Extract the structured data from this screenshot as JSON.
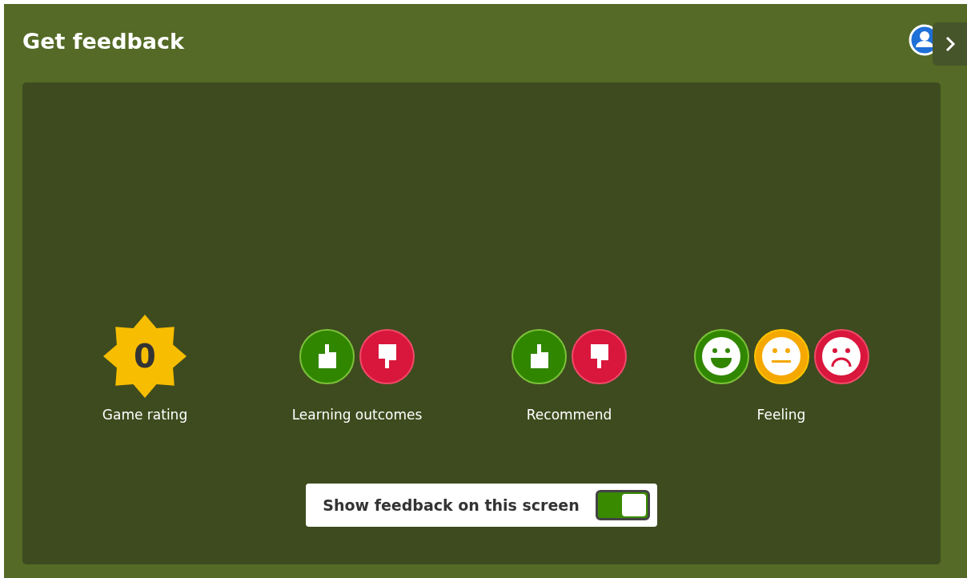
{
  "header": {
    "title": "Get feedback"
  },
  "groups": [
    {
      "kind": "rating",
      "value": "0",
      "label": "Game rating"
    },
    {
      "kind": "choices",
      "label": "Learning outcomes",
      "options": [
        {
          "kind": "thumbs-up"
        },
        {
          "kind": "thumbs-down"
        }
      ]
    },
    {
      "kind": "choices",
      "label": "Recommend",
      "options": [
        {
          "kind": "thumbs-up"
        },
        {
          "kind": "thumbs-down"
        }
      ]
    },
    {
      "kind": "choices",
      "label": "Feeling",
      "options": [
        {
          "kind": "happy"
        },
        {
          "kind": "neutral"
        },
        {
          "kind": "sad"
        }
      ]
    }
  ],
  "toggle": {
    "label": "Show feedback on this screen",
    "on": true
  }
}
